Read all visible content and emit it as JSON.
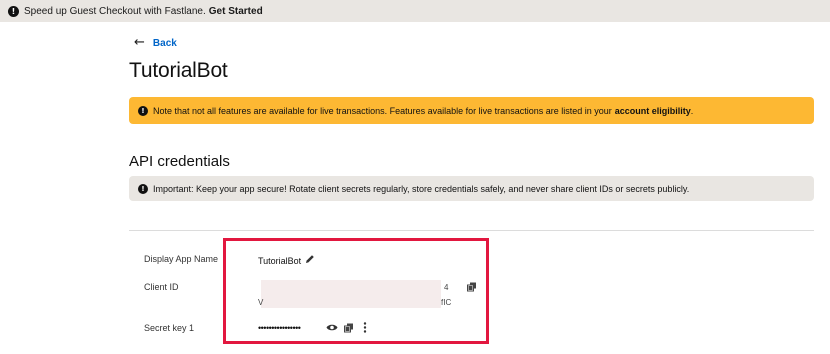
{
  "banner": {
    "text": "Speed up Guest Checkout with Fastlane.",
    "link": "Get Started"
  },
  "nav": {
    "back_label": "Back"
  },
  "page": {
    "title": "TutorialBot"
  },
  "notice": {
    "text": "Note that not all features are available for live transactions. Features available for live transactions are listed in your",
    "link": "account eligibility",
    "suffix": "."
  },
  "api_credentials": {
    "title": "API credentials",
    "important": "Important: Keep your app secure! Rotate client secrets regularly, store credentials safely, and never share client IDs or secrets publicly."
  },
  "fields": {
    "display_name_label": "Display App Name",
    "display_name_value": "TutorialBot",
    "client_id_label": "Client ID",
    "client_id_line1_end": "4",
    "client_id_line2_start": "V",
    "client_id_line2_end": "fIC",
    "secret_key_label": "Secret key 1",
    "secret_key_value": "••••••••••••••••"
  },
  "colors": {
    "link": "#0065c8",
    "warning": "#fdb833",
    "info_bg": "#e9e6e2",
    "highlight": "#e2173f"
  },
  "icons": [
    "info-icon",
    "back-arrow-icon",
    "pencil-icon",
    "copy-icon",
    "eye-icon",
    "more-vertical-icon"
  ]
}
